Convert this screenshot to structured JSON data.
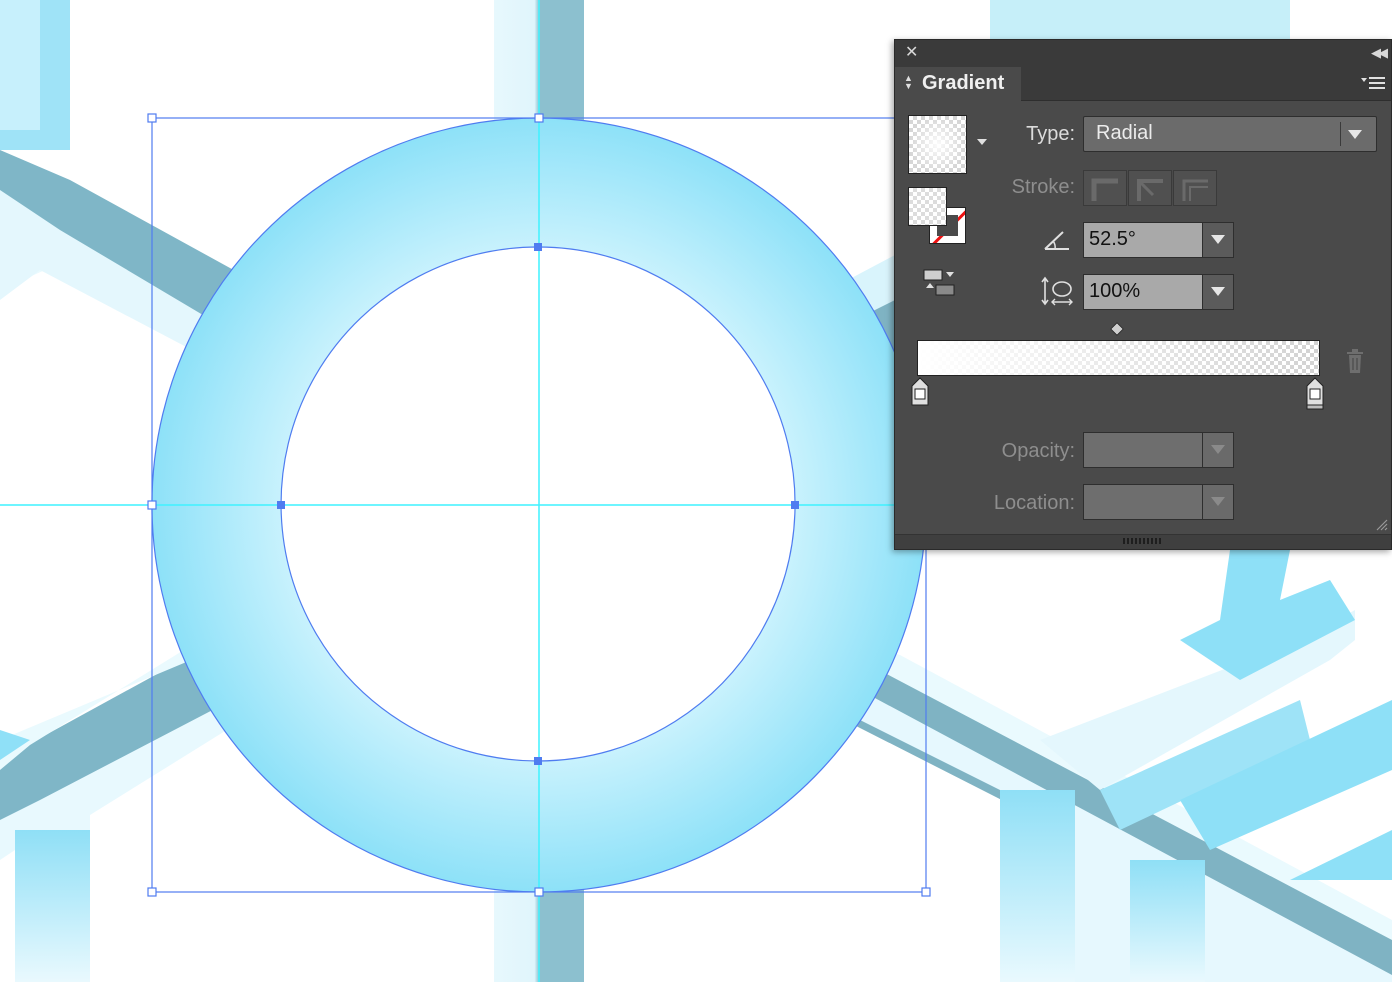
{
  "panel": {
    "tab_title": "Gradient",
    "type_label": "Type:",
    "type_value": "Radial",
    "stroke_label": "Stroke:",
    "angle_value": "52.5°",
    "aspect_value": "100%",
    "opacity_label": "Opacity:",
    "opacity_value": "",
    "location_label": "Location:",
    "location_value": ""
  },
  "icons": {
    "close": "close-icon",
    "collapse": "collapse-arrows-icon",
    "menu": "panel-menu-icon",
    "angle": "angle-icon",
    "aspect": "aspect-ratio-icon",
    "reverse": "reverse-gradient-icon",
    "trash": "delete-stop-icon"
  },
  "colors": {
    "artwork_fill": "#8ee0f7",
    "artwork_shadow": "#6fa9ba",
    "guide": "#3ff2ff",
    "selection": "#4f7cf0",
    "panel_bg": "#4a4a4a"
  }
}
